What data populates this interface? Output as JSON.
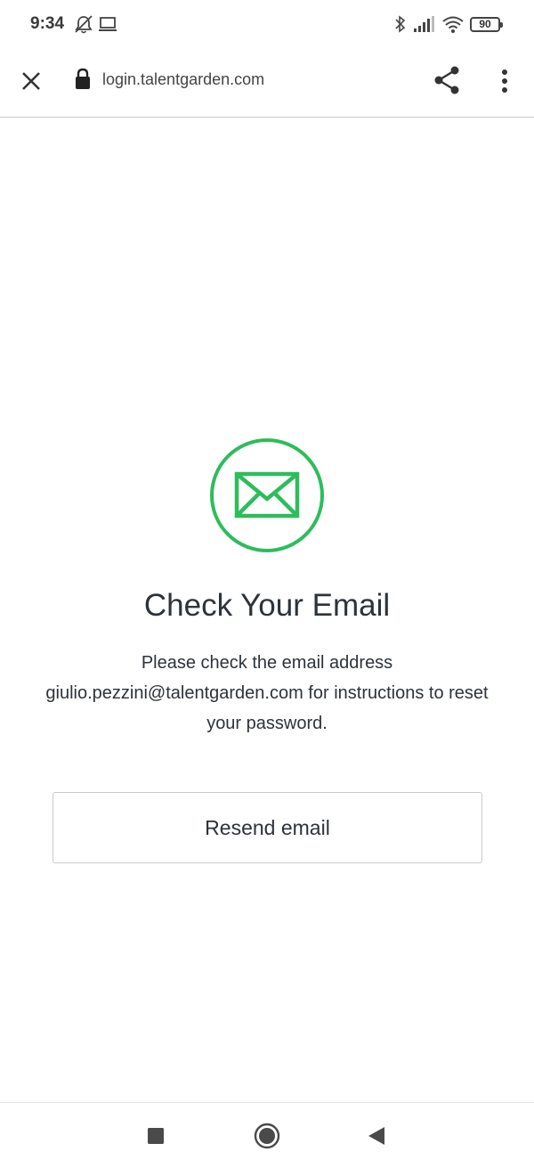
{
  "status_bar": {
    "time": "9:34",
    "battery": "90",
    "icons": [
      "alarm-off-icon",
      "laptop-icon",
      "bluetooth-icon",
      "signal-icon",
      "wifi-icon",
      "battery-icon"
    ]
  },
  "browser": {
    "url": "login.talentgarden.com",
    "icons": [
      "close-icon",
      "lock-icon",
      "share-icon",
      "more-vert-icon"
    ]
  },
  "main": {
    "icon": "envelope-icon",
    "accent_color": "#2dbd5b",
    "title": "Check Your Email",
    "message": "Please check the email address giulio.pezzini@talentgarden.com for instructions to reset your password.",
    "resend_label": "Resend email"
  },
  "nav": {
    "icons": [
      "recents-square-icon",
      "home-circle-icon",
      "back-triangle-icon"
    ]
  }
}
